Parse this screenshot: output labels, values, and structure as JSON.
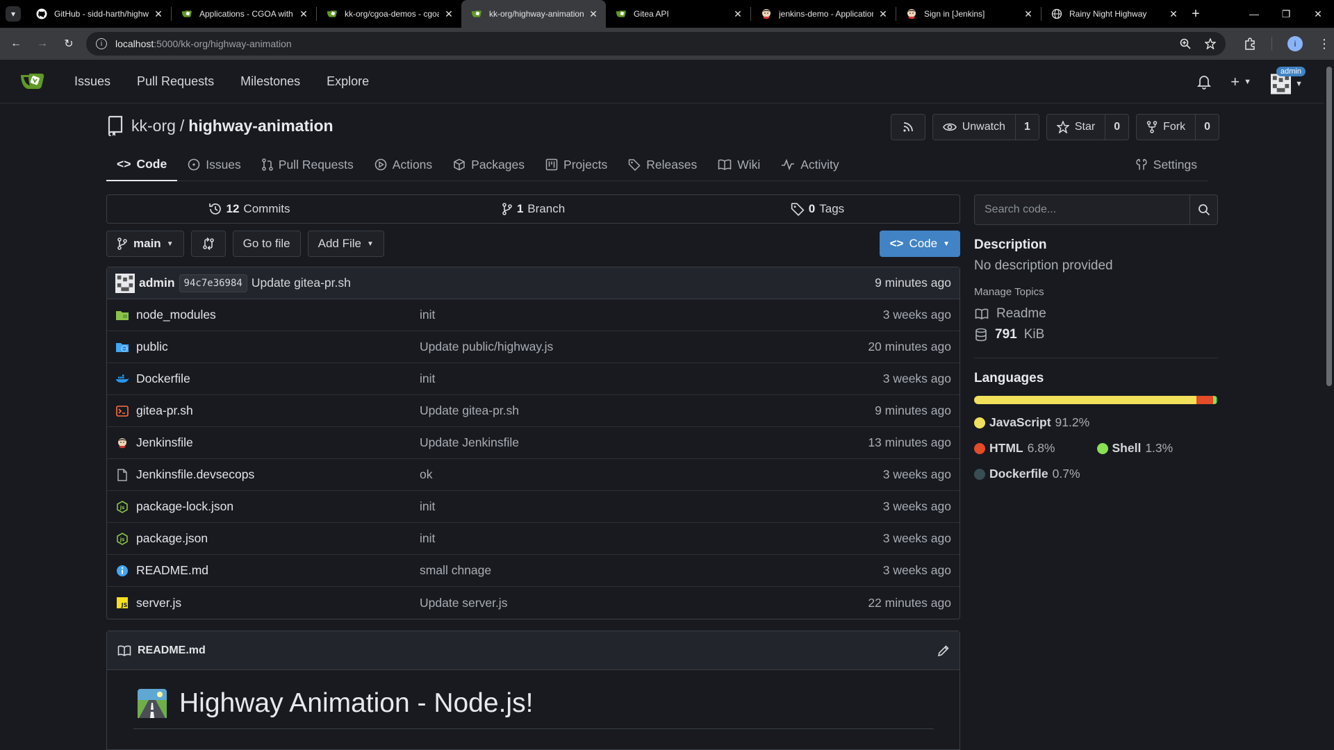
{
  "browser": {
    "tabs": [
      {
        "title": "GitHub - sidd-harth/highway",
        "icon": "github-icon",
        "active": false
      },
      {
        "title": "Applications - CGOA with",
        "icon": "gitea-icon",
        "active": false
      },
      {
        "title": "kk-org/cgoa-demos - cgoa",
        "icon": "gitea-icon",
        "active": false
      },
      {
        "title": "kk-org/highway-animation",
        "icon": "gitea-icon",
        "active": true
      },
      {
        "title": "Gitea API",
        "icon": "gitea-icon",
        "active": false
      },
      {
        "title": "jenkins-demo - Application",
        "icon": "jenkins-icon",
        "active": false
      },
      {
        "title": "Sign in [Jenkins]",
        "icon": "jenkins-icon",
        "active": false
      },
      {
        "title": "Rainy Night Highway",
        "icon": "globe-icon",
        "active": false
      }
    ],
    "url_host": "localhost",
    "url_path": ":5000/kk-org/highway-animation",
    "profile_initial": "i"
  },
  "nav": {
    "items": [
      "Issues",
      "Pull Requests",
      "Milestones",
      "Explore"
    ],
    "user_badge": "admin"
  },
  "repo": {
    "owner": "kk-org",
    "separator": "/",
    "name": "highway-animation",
    "unwatch_label": "Unwatch",
    "watch_count": "1",
    "star_label": "Star",
    "star_count": "0",
    "fork_label": "Fork",
    "fork_count": "0"
  },
  "tabs": {
    "code": "Code",
    "issues": "Issues",
    "pulls": "Pull Requests",
    "actions": "Actions",
    "packages": "Packages",
    "projects": "Projects",
    "releases": "Releases",
    "wiki": "Wiki",
    "activity": "Activity",
    "settings": "Settings"
  },
  "stats": {
    "commits_count": "12",
    "commits_label": "Commits",
    "branch_count": "1",
    "branch_label": "Branch",
    "tags_count": "0",
    "tags_label": "Tags"
  },
  "toolbar": {
    "branch": "main",
    "goto_file": "Go to file",
    "add_file": "Add File",
    "code": "Code"
  },
  "latest_commit": {
    "author": "admin",
    "sha": "94c7e36984",
    "message": "Update gitea-pr.sh",
    "time": "9 minutes ago"
  },
  "files": [
    {
      "name": "node_modules",
      "message": "init",
      "time": "3 weeks ago",
      "icon": "folder-icon"
    },
    {
      "name": "public",
      "message": "Update public/highway.js",
      "time": "20 minutes ago",
      "icon": "public-folder-icon"
    },
    {
      "name": "Dockerfile",
      "message": "init",
      "time": "3 weeks ago",
      "icon": "docker-icon"
    },
    {
      "name": "gitea-pr.sh",
      "message": "Update gitea-pr.sh",
      "time": "9 minutes ago",
      "icon": "shell-icon"
    },
    {
      "name": "Jenkinsfile",
      "message": "Update Jenkinsfile",
      "time": "13 minutes ago",
      "icon": "jenkins-icon"
    },
    {
      "name": "Jenkinsfile.devsecops",
      "message": "ok",
      "time": "3 weeks ago",
      "icon": "file-icon"
    },
    {
      "name": "package-lock.json",
      "message": "init",
      "time": "3 weeks ago",
      "icon": "nodejs-icon"
    },
    {
      "name": "package.json",
      "message": "init",
      "time": "3 weeks ago",
      "icon": "nodejs-icon"
    },
    {
      "name": "README.md",
      "message": "small chnage",
      "time": "3 weeks ago",
      "icon": "info-icon"
    },
    {
      "name": "server.js",
      "message": "Update server.js",
      "time": "22 minutes ago",
      "icon": "javascript-icon"
    }
  ],
  "readme": {
    "filename": "README.md",
    "title": "Highway Animation - Node.js!"
  },
  "sidebar": {
    "search_placeholder": "Search code...",
    "description_heading": "Description",
    "description": "No description provided",
    "manage_topics": "Manage Topics",
    "readme_label": "Readme",
    "size_value": "791",
    "size_unit": "KiB",
    "languages_heading": "Languages",
    "languages": [
      {
        "name": "JavaScript",
        "percent": "91.2%",
        "value": 91.2,
        "color": "#f1e05a"
      },
      {
        "name": "HTML",
        "percent": "6.8%",
        "value": 6.8,
        "color": "#e34c26"
      },
      {
        "name": "Shell",
        "percent": "1.3%",
        "value": 1.3,
        "color": "#89e051"
      },
      {
        "name": "Dockerfile",
        "percent": "0.7%",
        "value": 0.7,
        "color": "#384d54"
      }
    ]
  },
  "colors": {
    "accent": "#4183c4",
    "background": "#181a1f"
  }
}
